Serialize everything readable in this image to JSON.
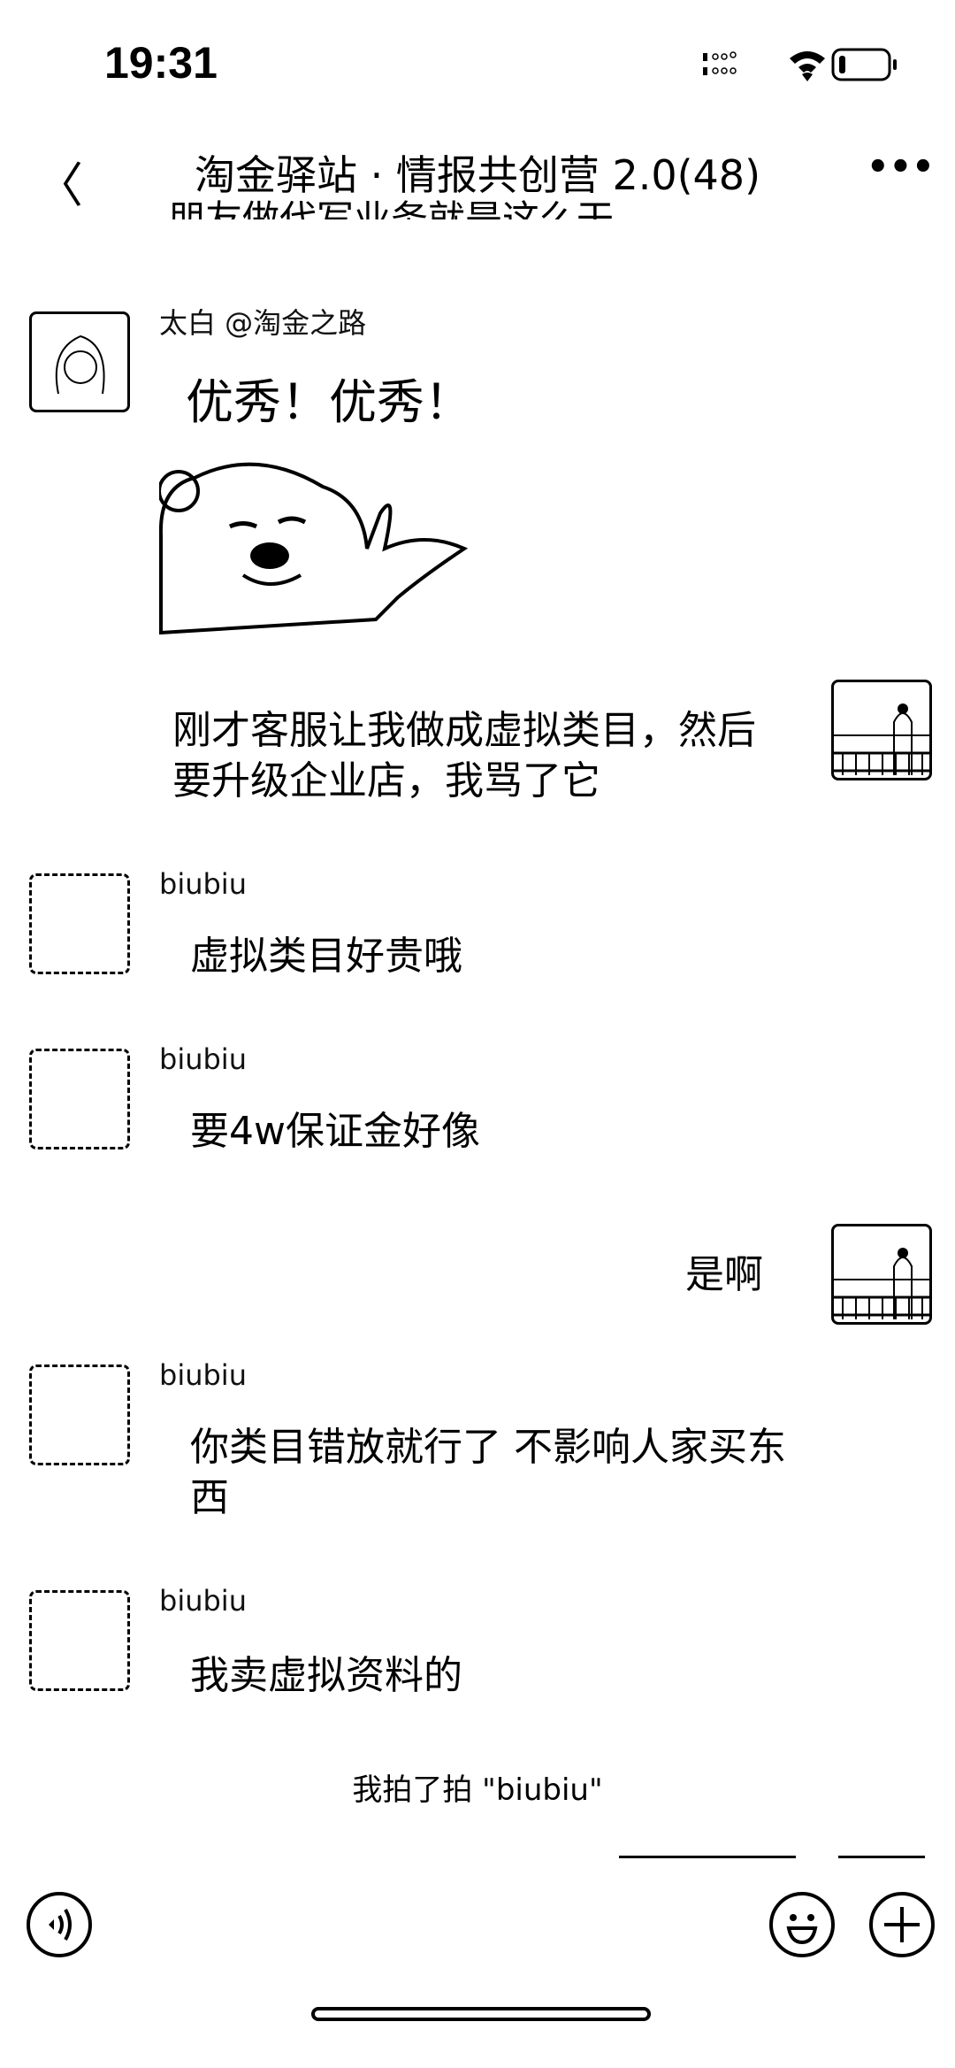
{
  "status_bar": {
    "time": "19:31",
    "icons": [
      "signal-icon",
      "wifi-icon",
      "battery-icon"
    ],
    "battery_level": 0.05
  },
  "header": {
    "title": "淘金驿站 · 情报共创营 2.0(48)",
    "back_icon": "chevron-left-icon",
    "more_icon": "more-icon"
  },
  "cut_message": "朋友做代写业务就是这么干",
  "messages": [
    {
      "sender": "太白 @淘金之路",
      "text": "优秀！优秀！"
    },
    {
      "sticker": "panda-meme-sticker"
    },
    {
      "sender": "me",
      "text": "刚才客服让我做成虚拟类目，然后要升级企业店，我骂了它"
    },
    {
      "sender": "biubiu",
      "text": "虚拟类目好贵哦"
    },
    {
      "sender": "biubiu",
      "text": "要4w保证金好像"
    },
    {
      "sender": "me",
      "text": "是啊"
    },
    {
      "sender": "biubiu",
      "text": "你类目错放就行了 不影响人家买东西"
    },
    {
      "sender": "biubiu",
      "text": "我卖虚拟资料的"
    }
  ],
  "system_message": "我拍了拍 \"biubiu\"",
  "input_bar": {
    "voice_icon": "voice-icon",
    "emoji_icon": "emoji-icon",
    "plus_icon": "plus-icon"
  }
}
